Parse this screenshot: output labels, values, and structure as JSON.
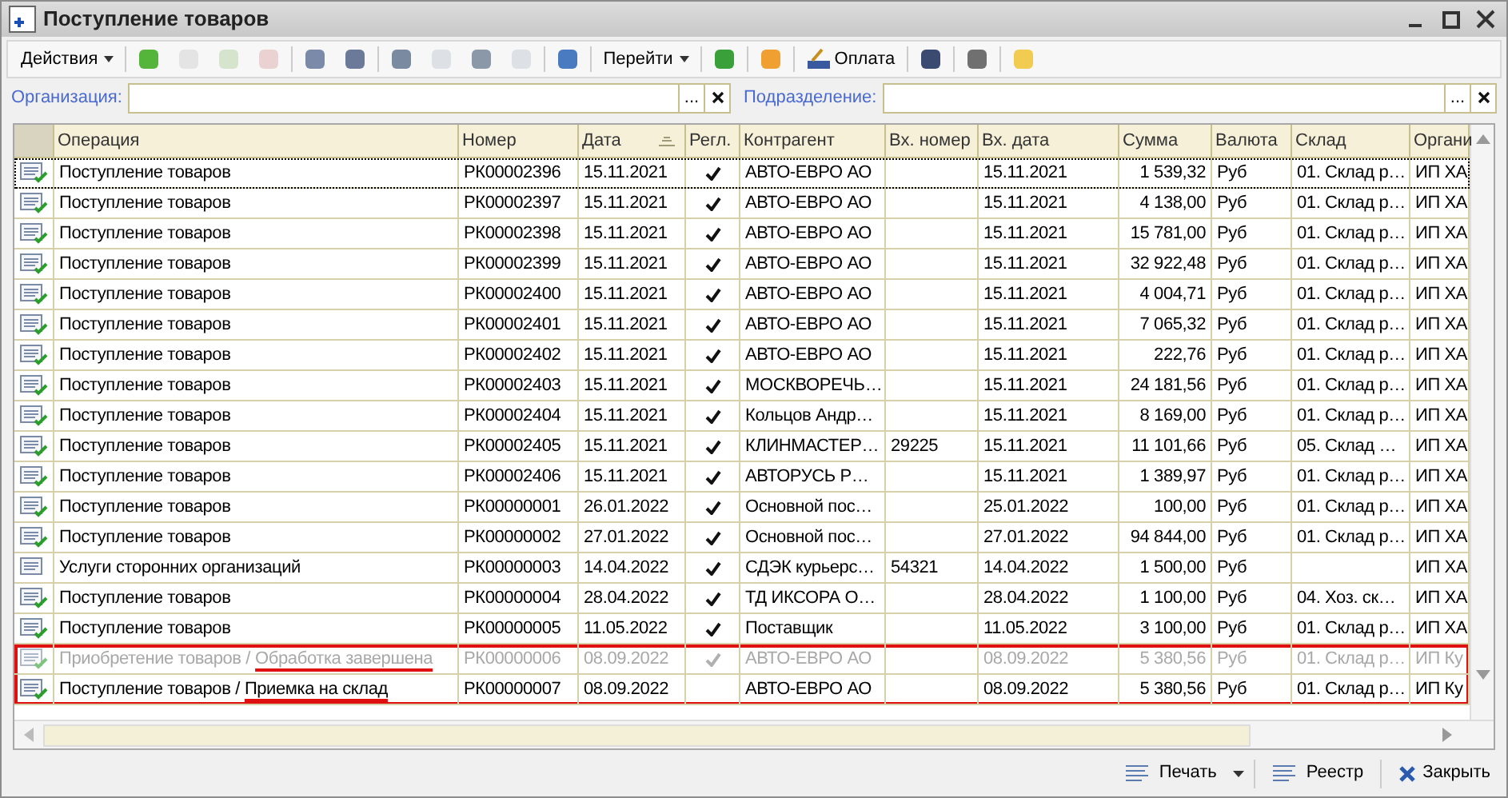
{
  "window": {
    "title": "Поступление товаров"
  },
  "toolbar": {
    "actions": "Действия",
    "goto": "Перейти",
    "payment": "Оплата"
  },
  "filters": [
    {
      "label": "Организация:",
      "button": "..."
    },
    {
      "label": "Подразделение:",
      "button": "..."
    }
  ],
  "table": {
    "columns": [
      {
        "label": "Операция",
        "sorted": false
      },
      {
        "label": "Номер",
        "sorted": false
      },
      {
        "label": "Дата",
        "sorted": true
      },
      {
        "label": "Регл.",
        "sorted": false
      },
      {
        "label": "Контрагент",
        "sorted": false
      },
      {
        "label": "Вх. номер",
        "sorted": false
      },
      {
        "label": "Вх. дата",
        "sorted": false
      },
      {
        "label": "Сумма",
        "sorted": false
      },
      {
        "label": "Валюта",
        "sorted": false
      },
      {
        "label": "Склад",
        "sorted": false
      },
      {
        "label": "Органи",
        "sorted": false
      }
    ],
    "rows": [
      {
        "kind": "posted",
        "selected": true,
        "dimmed": false,
        "highlighted": false,
        "operation": "Поступление товаров",
        "number": "РК00002396",
        "date": "15.11.2021",
        "regl": true,
        "counterparty": "АВТО-ЕВРО АО",
        "in_date": "15.11.2021",
        "sum": "1 539,32",
        "currency": "Руб",
        "warehouse": "01. Склад р…",
        "org": "ИП ХА"
      },
      {
        "kind": "posted",
        "selected": false,
        "dimmed": false,
        "highlighted": false,
        "operation": "Поступление товаров",
        "number": "РК00002397",
        "date": "15.11.2021",
        "regl": true,
        "counterparty": "АВТО-ЕВРО АО",
        "in_date": "15.11.2021",
        "sum": "4 138,00",
        "currency": "Руб",
        "warehouse": "01. Склад р…",
        "org": "ИП ХА"
      },
      {
        "kind": "posted",
        "selected": false,
        "dimmed": false,
        "highlighted": false,
        "operation": "Поступление товаров",
        "number": "РК00002398",
        "date": "15.11.2021",
        "regl": true,
        "counterparty": "АВТО-ЕВРО АО",
        "in_date": "15.11.2021",
        "sum": "15 781,00",
        "currency": "Руб",
        "warehouse": "01. Склад р…",
        "org": "ИП ХА"
      },
      {
        "kind": "posted",
        "selected": false,
        "dimmed": false,
        "highlighted": false,
        "operation": "Поступление товаров",
        "number": "РК00002399",
        "date": "15.11.2021",
        "regl": true,
        "counterparty": "АВТО-ЕВРО АО",
        "in_date": "15.11.2021",
        "sum": "32 922,48",
        "currency": "Руб",
        "warehouse": "01. Склад р…",
        "org": "ИП ХА"
      },
      {
        "kind": "posted",
        "selected": false,
        "dimmed": false,
        "highlighted": false,
        "operation": "Поступление товаров",
        "number": "РК00002400",
        "date": "15.11.2021",
        "regl": true,
        "counterparty": "АВТО-ЕВРО АО",
        "in_date": "15.11.2021",
        "sum": "4 004,71",
        "currency": "Руб",
        "warehouse": "01. Склад р…",
        "org": "ИП ХА"
      },
      {
        "kind": "posted",
        "selected": false,
        "dimmed": false,
        "highlighted": false,
        "operation": "Поступление товаров",
        "number": "РК00002401",
        "date": "15.11.2021",
        "regl": true,
        "counterparty": "АВТО-ЕВРО АО",
        "in_date": "15.11.2021",
        "sum": "7 065,32",
        "currency": "Руб",
        "warehouse": "01. Склад р…",
        "org": "ИП ХА"
      },
      {
        "kind": "posted",
        "selected": false,
        "dimmed": false,
        "highlighted": false,
        "operation": "Поступление товаров",
        "number": "РК00002402",
        "date": "15.11.2021",
        "regl": true,
        "counterparty": "АВТО-ЕВРО АО",
        "in_date": "15.11.2021",
        "sum": "222,76",
        "currency": "Руб",
        "warehouse": "01. Склад р…",
        "org": "ИП ХА"
      },
      {
        "kind": "posted",
        "selected": false,
        "dimmed": false,
        "highlighted": false,
        "operation": "Поступление товаров",
        "number": "РК00002403",
        "date": "15.11.2021",
        "regl": true,
        "counterparty": "МОСКВОРЕЧЬ…",
        "in_date": "15.11.2021",
        "sum": "24 181,56",
        "currency": "Руб",
        "warehouse": "01. Склад р…",
        "org": "ИП ХА"
      },
      {
        "kind": "posted",
        "selected": false,
        "dimmed": false,
        "highlighted": false,
        "operation": "Поступление товаров",
        "number": "РК00002404",
        "date": "15.11.2021",
        "regl": true,
        "counterparty": "Кольцов Андр…",
        "in_date": "15.11.2021",
        "sum": "8 169,00",
        "currency": "Руб",
        "warehouse": "01. Склад р…",
        "org": "ИП ХА"
      },
      {
        "kind": "posted",
        "selected": false,
        "dimmed": false,
        "highlighted": false,
        "operation": "Поступление товаров",
        "number": "РК00002405",
        "date": "15.11.2021",
        "regl": true,
        "counterparty": "КЛИНМАСТЕР…",
        "in_number": "29225",
        "in_date": "15.11.2021",
        "sum": "11 101,66",
        "currency": "Руб",
        "warehouse": "05. Склад …",
        "org": "ИП ХА"
      },
      {
        "kind": "posted",
        "selected": false,
        "dimmed": false,
        "highlighted": false,
        "operation": "Поступление товаров",
        "number": "РК00002406",
        "date": "15.11.2021",
        "regl": true,
        "counterparty": "АВТОРУСЬ Р…",
        "in_date": "15.11.2021",
        "sum": "1 389,97",
        "currency": "Руб",
        "warehouse": "01. Склад р…",
        "org": "ИП ХА"
      },
      {
        "kind": "posted",
        "selected": false,
        "dimmed": false,
        "highlighted": false,
        "operation": "Поступление товаров",
        "number": "РК00000001",
        "date": "26.01.2022",
        "regl": true,
        "counterparty": "Основной пос…",
        "in_date": "25.01.2022",
        "sum": "100,00",
        "currency": "Руб",
        "warehouse": "01. Склад р…",
        "org": "ИП ХА"
      },
      {
        "kind": "posted",
        "selected": false,
        "dimmed": false,
        "highlighted": false,
        "operation": "Поступление товаров",
        "number": "РК00000002",
        "date": "27.01.2022",
        "regl": true,
        "counterparty": "Основной пос…",
        "in_date": "27.01.2022",
        "sum": "94 844,00",
        "currency": "Руб",
        "warehouse": "01. Склад р…",
        "org": "ИП ХА"
      },
      {
        "kind": "plain",
        "selected": false,
        "dimmed": false,
        "highlighted": false,
        "operation": "Услуги сторонних организаций",
        "number": "РК00000003",
        "date": "14.04.2022",
        "regl": true,
        "counterparty": "СДЭК курьерс…",
        "in_number": "54321",
        "in_date": "14.04.2022",
        "sum": "1 500,00",
        "currency": "Руб",
        "org": "ИП ХА"
      },
      {
        "kind": "posted",
        "selected": false,
        "dimmed": false,
        "highlighted": false,
        "operation": "Поступление товаров",
        "number": "РК00000004",
        "date": "28.04.2022",
        "regl": true,
        "counterparty": "ТД ИКСОРА О…",
        "in_date": "28.04.2022",
        "sum": "1 100,00",
        "currency": "Руб",
        "warehouse": "04. Хоз. ск…",
        "org": "ИП ХА"
      },
      {
        "kind": "posted",
        "selected": false,
        "dimmed": false,
        "highlighted": false,
        "operation": "Поступление товаров",
        "number": "РК00000005",
        "date": "11.05.2022",
        "regl": true,
        "counterparty": "Поставщик",
        "in_date": "11.05.2022",
        "sum": "3 100,00",
        "currency": "Руб",
        "warehouse": "01. Склад р…",
        "org": "ИП ХА"
      },
      {
        "kind": "posted",
        "selected": false,
        "dimmed": true,
        "highlighted": true,
        "operation": "Приобретение товаров /",
        "status": "Обработка завершена",
        "number": "РК00000006",
        "date": "08.09.2022",
        "regl": true,
        "counterparty": "АВТО-ЕВРО АО",
        "in_date": "08.09.2022",
        "sum": "5 380,56",
        "currency": "Руб",
        "warehouse": "01. Склад р…",
        "org": "ИП Ку"
      },
      {
        "kind": "posted",
        "selected": false,
        "dimmed": false,
        "highlighted": true,
        "operation": "Поступление товаров /",
        "status": "Приемка на склад",
        "number": "РК00000007",
        "date": "08.09.2022",
        "regl": false,
        "counterparty": "АВТО-ЕВРО АО",
        "in_date": "08.09.2022",
        "sum": "5 380,56",
        "currency": "Руб",
        "warehouse": "01. Склад р…",
        "org": "ИП Ку"
      }
    ]
  },
  "footer": {
    "print": "Печать",
    "registry": "Реестр",
    "close": "Закрыть"
  }
}
